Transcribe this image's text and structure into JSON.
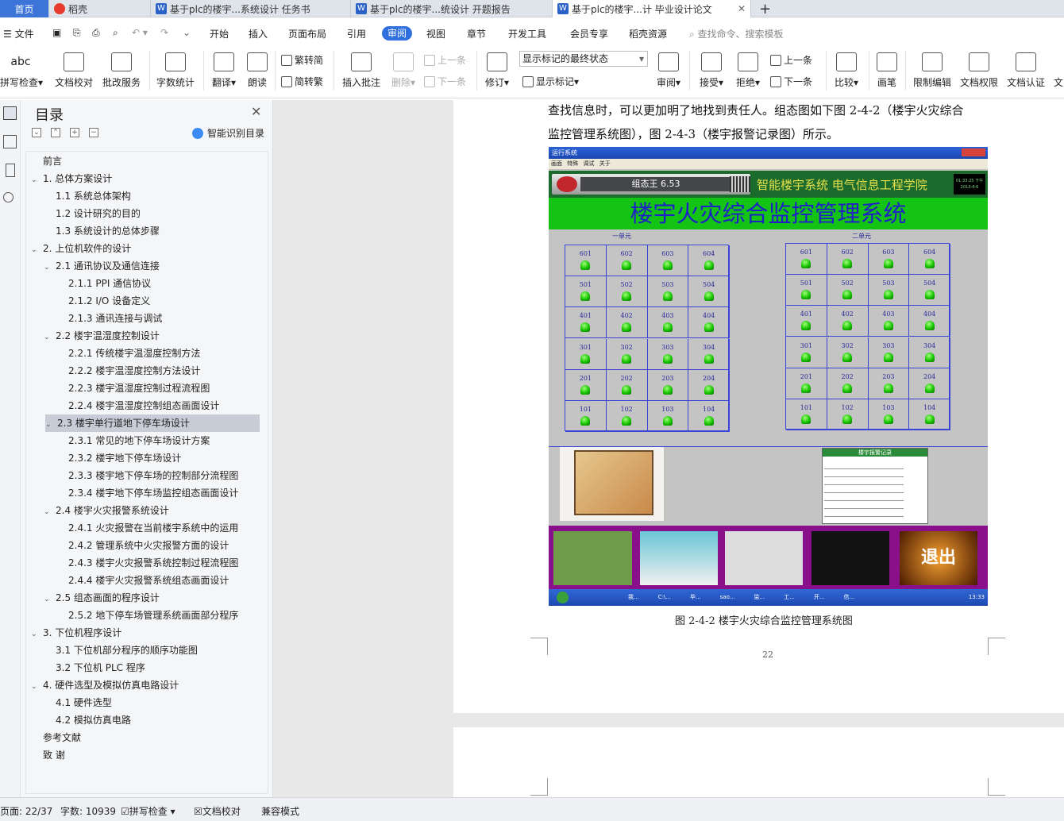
{
  "tabs": [
    {
      "label": "首页"
    },
    {
      "label": "稻壳"
    },
    {
      "label": "基于plc的楼宇...系统设计 任务书"
    },
    {
      "label": "基于plc的楼宇...统设计 开题报告"
    },
    {
      "label": "基于plc的楼宇...计 毕业设计论文"
    }
  ],
  "new_tab": "+",
  "menu": {
    "file": "文件",
    "items": [
      "开始",
      "插入",
      "页面布局",
      "引用",
      "审阅",
      "视图",
      "章节",
      "开发工具",
      "会员专享",
      "稻壳资源"
    ],
    "active": "审阅",
    "search_placeholder": "查找命令、搜索模板"
  },
  "toolbar": {
    "spell_check": "拼写检查",
    "doc_proof": "文档校对",
    "revise_service": "批改服务",
    "word_count": "字数统计",
    "translate": "翻译",
    "read_aloud": "朗读",
    "to_traditional": "繁转简",
    "to_simplified": "简转繁",
    "insert_comment": "插入批注",
    "delete": "删除",
    "prev_comment": "上一条",
    "next_comment": "下一条",
    "track_changes": "修订",
    "markup_select": "显示标记的最终状态",
    "show_markup": "显示标记",
    "review": "审阅",
    "accept": "接受",
    "reject": "拒绝",
    "prev_change": "上一条",
    "next_change": "下一条",
    "compare": "比较",
    "pen": "画笔",
    "restrict_edit": "限制编辑",
    "doc_permission": "文档权限",
    "doc_cert": "文档认证",
    "more": "文"
  },
  "toc": {
    "title": "目录",
    "smart_toc": "智能识别目录",
    "items": [
      {
        "label": "前言",
        "level": 0,
        "chev": false
      },
      {
        "label": "1.  总体方案设计",
        "level": 0,
        "chev": true
      },
      {
        "label": "1.1  系统总体架构",
        "level": 1,
        "chev": false
      },
      {
        "label": "1.2  设计研究的目的",
        "level": 1,
        "chev": false
      },
      {
        "label": "1.3  系统设计的总体步骤",
        "level": 1,
        "chev": false
      },
      {
        "label": "2.  上位机软件的设计",
        "level": 0,
        "chev": true
      },
      {
        "label": "2.1  通讯协议及通信连接",
        "level": 1,
        "chev": true
      },
      {
        "label": "2.1.1 PPI 通信协议",
        "level": 2,
        "chev": false
      },
      {
        "label": "2.1.2 I/O 设备定义",
        "level": 2,
        "chev": false
      },
      {
        "label": "2.1.3  通讯连接与调试",
        "level": 2,
        "chev": false
      },
      {
        "label": "2.2  楼宇温湿度控制设计",
        "level": 1,
        "chev": true
      },
      {
        "label": "2.2.1  传统楼宇温湿度控制方法",
        "level": 2,
        "chev": false
      },
      {
        "label": "2.2.2  楼宇温湿度控制方法设计",
        "level": 2,
        "chev": false
      },
      {
        "label": "2.2.3  楼宇温湿度控制过程流程图",
        "level": 2,
        "chev": false
      },
      {
        "label": "2.2.4  楼宇温湿度控制组态画面设计",
        "level": 2,
        "chev": false
      },
      {
        "label": "2.3  楼宇单行道地下停车场设计",
        "level": 1,
        "chev": true,
        "selected": true
      },
      {
        "label": "2.3.1  常见的地下停车场设计方案",
        "level": 2,
        "chev": false
      },
      {
        "label": "2.3.2  楼宇地下停车场设计",
        "level": 2,
        "chev": false
      },
      {
        "label": "2.3.3  楼宇地下停车场的控制部分流程图",
        "level": 2,
        "chev": false
      },
      {
        "label": "2.3.4  楼宇地下停车场监控组态画面设计",
        "level": 2,
        "chev": false
      },
      {
        "label": "2.4  楼宇火灾报警系统设计",
        "level": 1,
        "chev": true
      },
      {
        "label": "2.4.1  火灾报警在当前楼宇系统中的运用",
        "level": 2,
        "chev": false
      },
      {
        "label": "2.4.2  管理系统中火灾报警方面的设计",
        "level": 2,
        "chev": false
      },
      {
        "label": "2.4.3  楼宇火灾报警系统控制过程流程图",
        "level": 2,
        "chev": false
      },
      {
        "label": "2.4.4  楼宇火灾报警系统组态画面设计",
        "level": 2,
        "chev": false
      },
      {
        "label": "2.5  组态画面的程序设计",
        "level": 1,
        "chev": true
      },
      {
        "label": "2.5.2  地下停车场管理系统画面部分程序",
        "level": 2,
        "chev": false
      },
      {
        "label": "3.  下位机程序设计",
        "level": 0,
        "chev": true
      },
      {
        "label": "3.1  下位机部分程序的顺序功能图",
        "level": 1,
        "chev": false
      },
      {
        "label": "3.2  下位机 PLC 程序",
        "level": 1,
        "chev": false
      },
      {
        "label": "4.  硬件选型及模拟仿真电路设计",
        "level": 0,
        "chev": true
      },
      {
        "label": "4.1  硬件选型",
        "level": 1,
        "chev": false
      },
      {
        "label": "4.2  模拟仿真电路",
        "level": 1,
        "chev": false
      },
      {
        "label": "参考文献",
        "level": 0,
        "chev": false
      },
      {
        "label": "致    谢",
        "level": 0,
        "chev": false
      }
    ]
  },
  "document": {
    "line1": "查找信息时，可以更加明了地找到责任人。组态图如下图 2-4-2（楼宇火灾综合",
    "line2": "监控管理系统图），图 2-4-3（楼宇报警记录图）所示。",
    "caption": "图 2-4-2 楼宇火灾综合监控管理系统图",
    "page_number": "22"
  },
  "scada": {
    "window_title": "运行系统",
    "menus": [
      "画面",
      "特殊",
      "调试",
      "关于"
    ],
    "banner_left": "组态王 6.53",
    "banner_right": "智能楼宇系统  电气信息工程学院",
    "clock": "01:33:25 下午",
    "date": "2013-4-6",
    "main_title": "楼宇火灾综合监控管理系统",
    "unit1": "一单元",
    "unit2": "二单元",
    "rooms": [
      [
        "601",
        "602",
        "603",
        "604"
      ],
      [
        "501",
        "502",
        "503",
        "504"
      ],
      [
        "401",
        "402",
        "403",
        "404"
      ],
      [
        "301",
        "302",
        "303",
        "304"
      ],
      [
        "201",
        "202",
        "203",
        "204"
      ],
      [
        "101",
        "102",
        "103",
        "104"
      ]
    ],
    "alarm_record": "楼宇报警记录",
    "exit_label": "退出",
    "taskbar_clock": "13:33",
    "taskbar_items": [
      "我...",
      "C:\\...",
      "毕...",
      "sao...",
      "监...",
      "工...",
      "开...",
      "信..."
    ]
  },
  "status": {
    "page": "页面: 22/37",
    "words": "字数: 10939",
    "spell": "拼写检查",
    "proof": "文档校对",
    "compat": "兼容模式"
  },
  "colors": {
    "accent": "#2f6fde",
    "tab_home": "#3c74d8",
    "scada_green": "#14c414",
    "scada_purple": "#8a0f8a"
  }
}
